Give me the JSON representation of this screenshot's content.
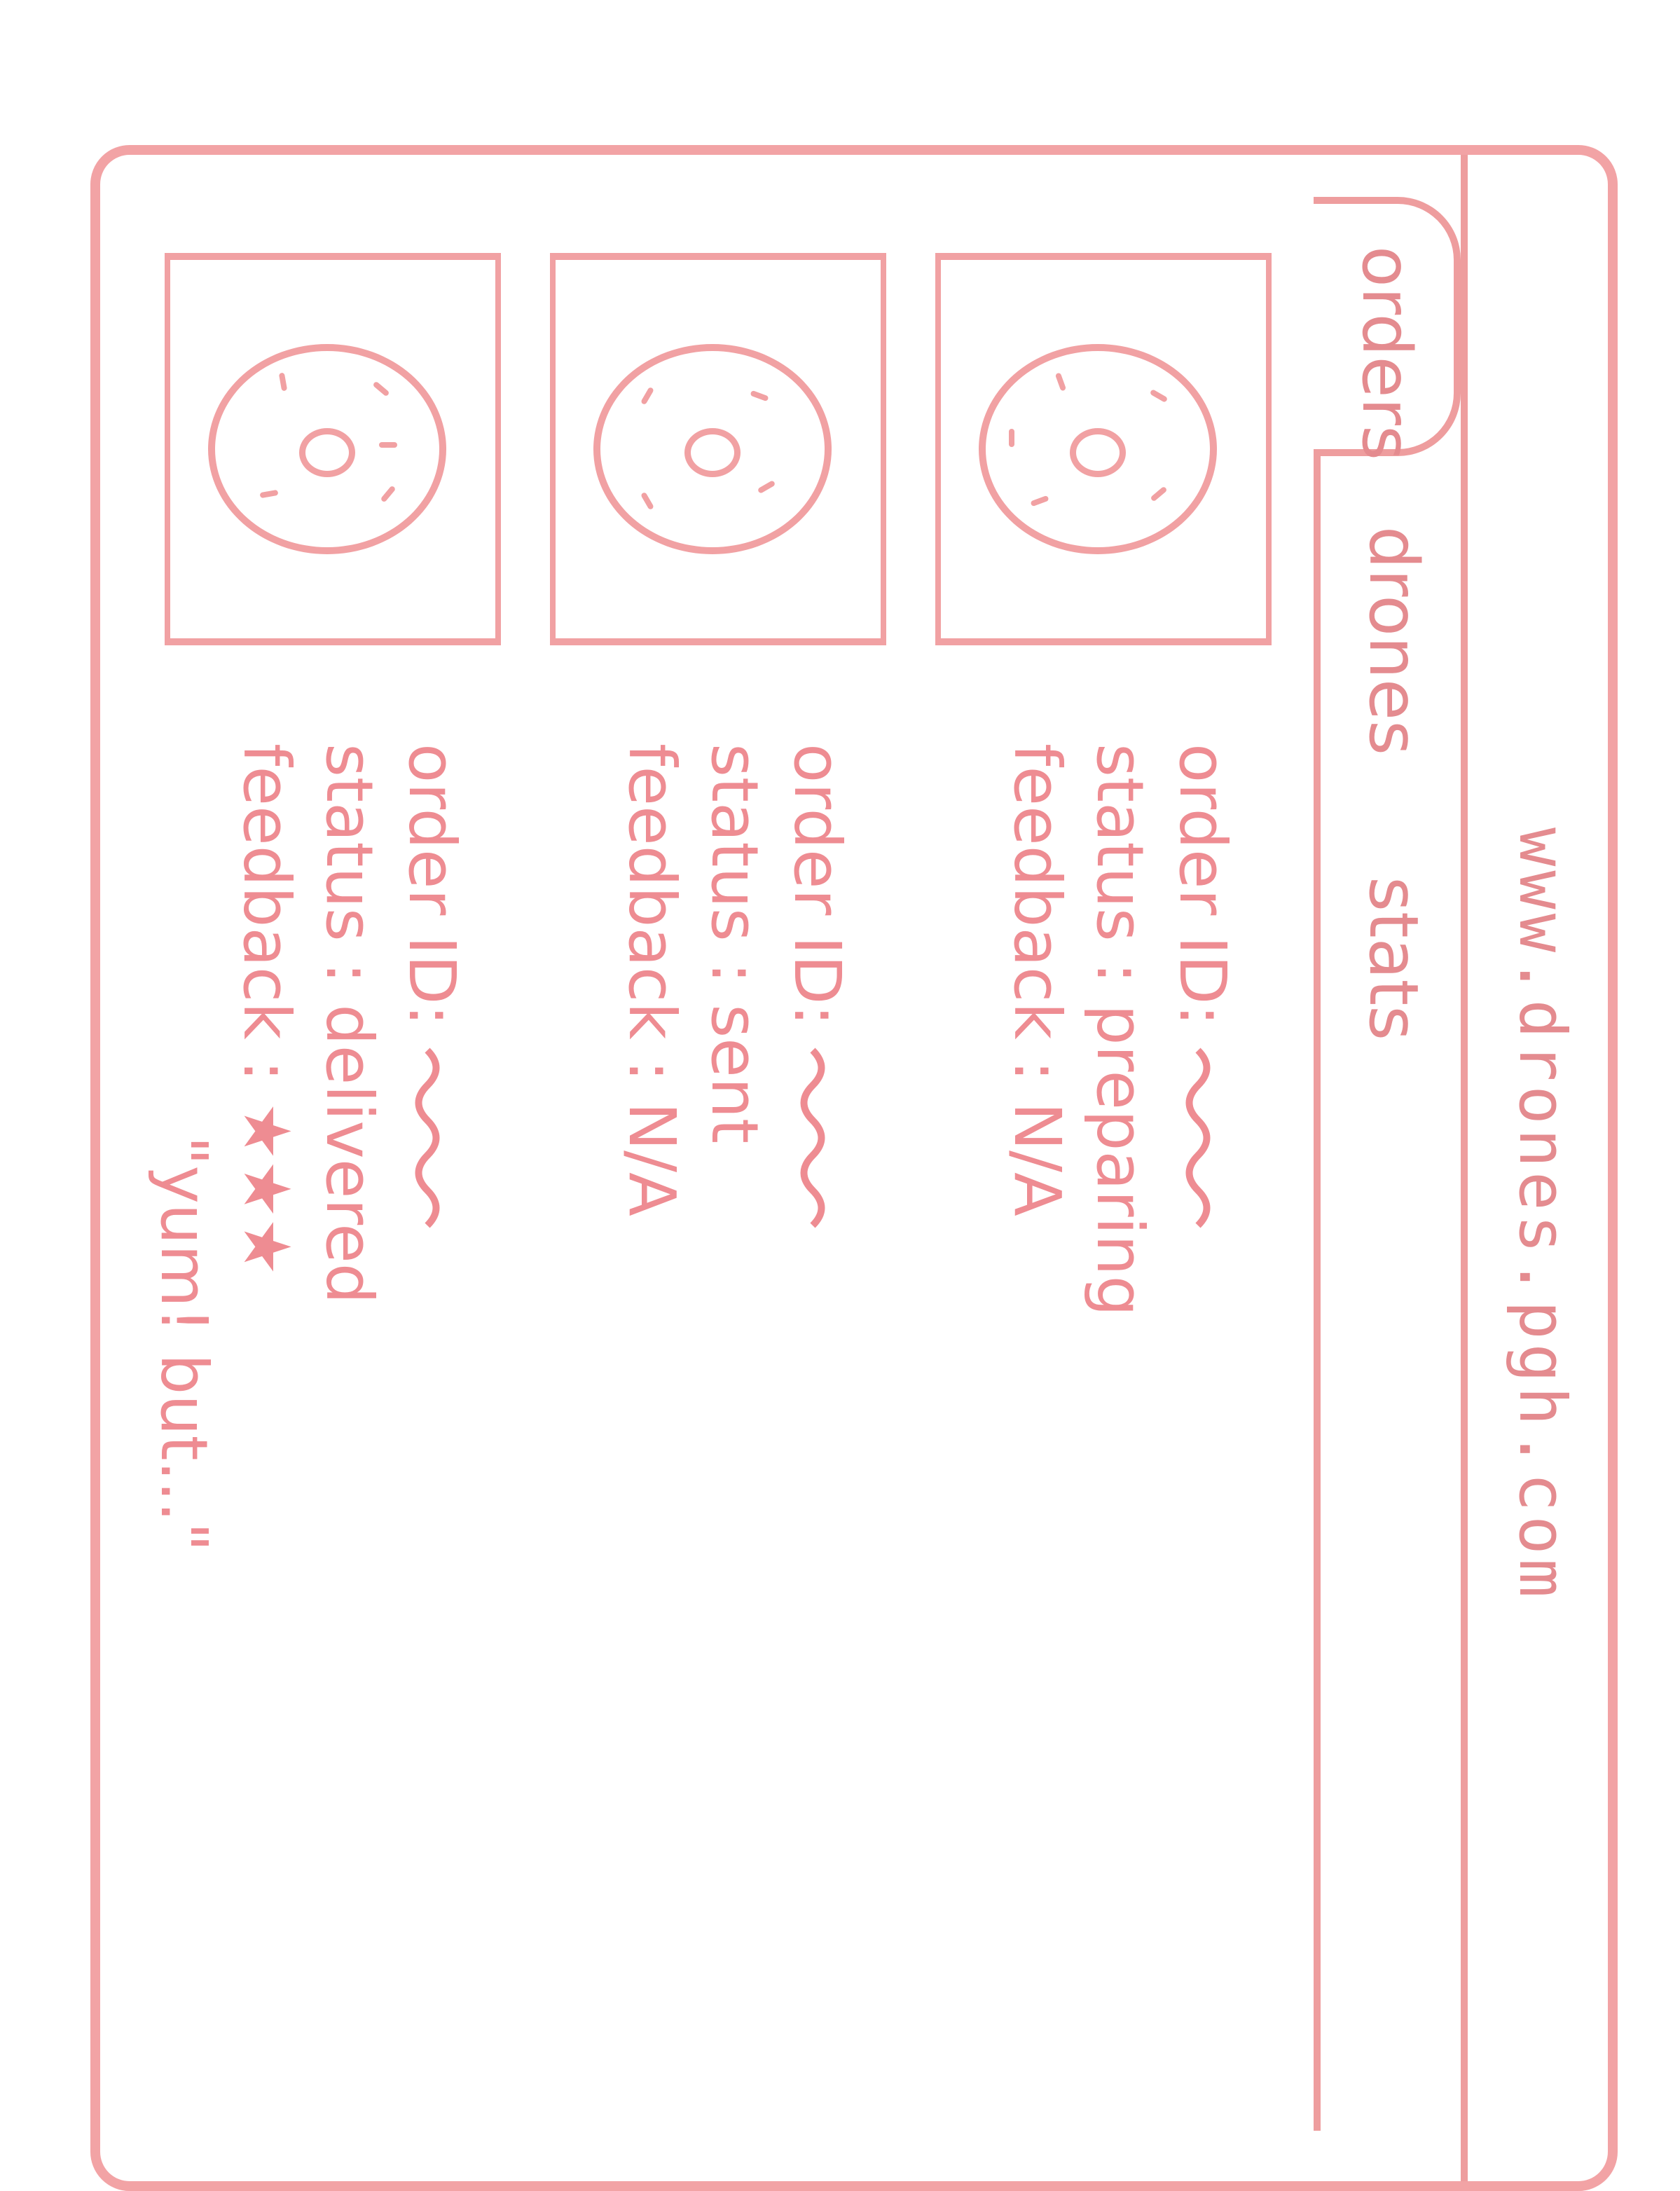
{
  "browser": {
    "url": "www.drones.pgh.com"
  },
  "tabs": [
    {
      "label": "orders"
    },
    {
      "label": "drones"
    },
    {
      "label": "stats"
    }
  ],
  "orders": [
    {
      "id_label": "order ID:",
      "status_label": "status :",
      "status": "preparing",
      "feedback_label": "feedback :",
      "feedback": "N/A"
    },
    {
      "id_label": "order ID:",
      "status_label": "status :",
      "status": "sent",
      "feedback_label": "feedback :",
      "feedback": "N/A"
    },
    {
      "id_label": "order ID:",
      "status_label": "status :",
      "status": "delivered",
      "feedback_label": "feedback :",
      "feedback_stars": "★★★",
      "feedback_rating": 3,
      "feedback_comment": "\"yum! but...\""
    }
  ],
  "colors": {
    "ink": "#ee9d9e",
    "ink_text": "#e48b8f"
  },
  "icons": [
    "donut-icon",
    "squiggle-placeholder-icon",
    "star-icon"
  ]
}
